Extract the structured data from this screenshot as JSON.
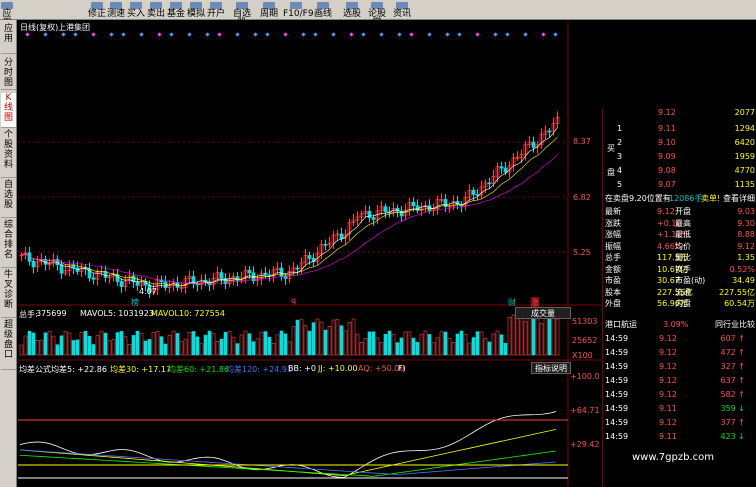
{
  "toolbar": {
    "buttons": [
      "应用",
      "修正",
      "测速",
      "买入",
      "卖出",
      "基金",
      "模拟",
      "开户",
      "自选股",
      "周期",
      "F10/F9",
      "画线",
      "选股",
      "论股堂",
      "资讯"
    ]
  },
  "sidebar": {
    "items": [
      "应\n用",
      "分\n时\n图",
      "K\n线\n图",
      "个\n股\n资\n料",
      "自\n选\n股",
      "综\n合\n排\n名",
      "牛\n叉\n诊\n断",
      "超\n级\n盘\n口"
    ],
    "active_index": 2
  },
  "chart_header": {
    "title": "日线(复权)",
    "stock_name": "上港集团"
  },
  "price_axis": [
    "8.37",
    "6.82",
    "5.25"
  ],
  "price_low_label": "4.07",
  "markers": [
    "榜",
    "q",
    "财",
    "涨"
  ],
  "volume_header": {
    "total_label": "总手:",
    "total_value": "375699",
    "mavol5": "MAVOL5: 1031923",
    "mavol10": "MAVOL10: 727554",
    "button": "成交量"
  },
  "volume_axis": [
    "51303",
    "25652",
    "X100"
  ],
  "indicator_header": {
    "name": "均差公式",
    "jc5": "均差5: +22.86",
    "jc30": "均差30: +17.17",
    "jc60": "均差60: +21.86",
    "jc120": "均差120: +24.91",
    "bb": "BB: +0",
    "jj": "JJ: +10.00",
    "aq": "AQ: +50.00",
    "f": "F)",
    "button": "指标说明"
  },
  "indicator_axis": [
    "+100.0",
    "+64.71",
    "+29.42"
  ],
  "order_book": {
    "buy_label_1": "买",
    "buy_label_2": "盘",
    "top_partial": {
      "price": "9.12",
      "vol": "2077"
    },
    "bids": [
      {
        "level": "1",
        "price": "9.11",
        "vol": "1294"
      },
      {
        "level": "2",
        "price": "9.10",
        "vol": "6420"
      },
      {
        "level": "3",
        "price": "9.09",
        "vol": "1959"
      },
      {
        "level": "4",
        "price": "9.08",
        "vol": "4770"
      },
      {
        "level": "5",
        "price": "9.07",
        "vol": "1135"
      }
    ],
    "notice": "在卖盘9.20位置有",
    "notice_vol": "12086手",
    "notice_sell": "卖单!",
    "notice_link": "查看详细"
  },
  "quote": [
    {
      "k1": "最新",
      "v1": "9.12",
      "k2": "开盘",
      "v2": "9.03"
    },
    {
      "k1": "涨跌",
      "v1": "+0.10",
      "k2": "最高",
      "v2": "9.30"
    },
    {
      "k1": "涨幅",
      "v1": "+1.11%",
      "k2": "最低",
      "v2": "8.88"
    },
    {
      "k1": "振幅",
      "v1": "4.66%",
      "k2": "均价",
      "v2": "9.12"
    },
    {
      "k1": "总手",
      "v1": "117.5万",
      "k2": "量比",
      "v2": "1.35"
    },
    {
      "k1": "金额",
      "v1": "10.67亿",
      "k2": "换手",
      "v2": "0.52%"
    },
    {
      "k1": "市盈",
      "v1": "30.67",
      "k2": "市盈(动)",
      "v2": "34.49"
    },
    {
      "k1": "股本",
      "v1": "227.55亿",
      "k2": "流通",
      "v2": "227.55亿"
    },
    {
      "k1": "外盘",
      "v1": "56.96万",
      "k2": "内盘",
      "v2": "60.54万"
    }
  ],
  "sector": {
    "name": "港口航运",
    "change": "3.09%",
    "rank_label": "同行业比较"
  },
  "ticks": [
    {
      "time": "14:59",
      "price": "9.12",
      "vol": "607",
      "dir": "up"
    },
    {
      "time": "14:59",
      "price": "9.12",
      "vol": "472",
      "dir": "up"
    },
    {
      "time": "14:59",
      "price": "9.12",
      "vol": "327",
      "dir": "up"
    },
    {
      "time": "14:59",
      "price": "9.12",
      "vol": "637",
      "dir": "up"
    },
    {
      "time": "14:59",
      "price": "9.12",
      "vol": "582",
      "dir": "up"
    },
    {
      "time": "14:59",
      "price": "9.11",
      "vol": "359",
      "dir": "down"
    },
    {
      "time": "14:59",
      "price": "9.12",
      "vol": "377",
      "dir": "up"
    },
    {
      "time": "14:59",
      "price": "9.11",
      "vol": "423",
      "dir": "down"
    }
  ],
  "watermark": "www.7gpzb.com",
  "colors": {
    "up": "#ff4040",
    "down": "#00e0e0",
    "ma5": "#ffffff",
    "ma10": "#ffff00",
    "ma20": "#ff00ff",
    "ma60": "#00ff00"
  }
}
